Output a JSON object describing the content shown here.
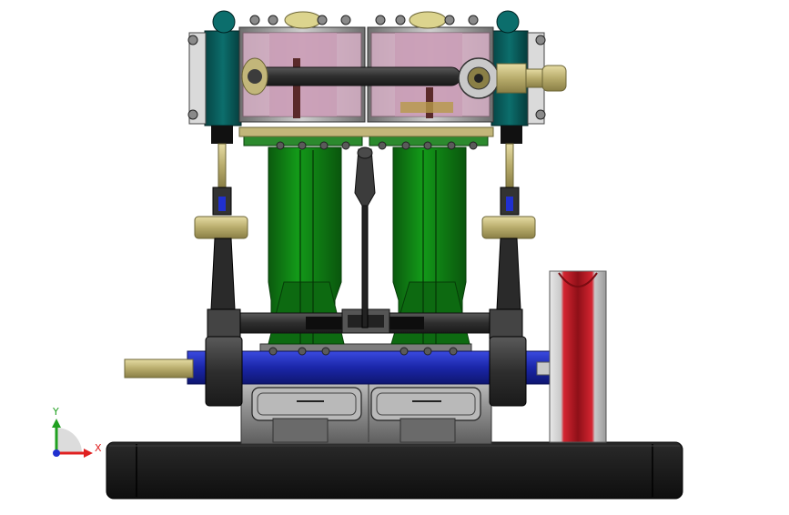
{
  "viewport": {
    "axes": {
      "x_label": "X",
      "y_label": "Y",
      "x_color": "#e02020",
      "y_color": "#20a020",
      "z_color": "#2030d0"
    }
  },
  "colors": {
    "base": "#1b1b1b",
    "frame_green": "#0f7a13",
    "cylinder_teal": "#0a5a5a",
    "glass_pink": "#d8b6c8",
    "shaft_blue": "#1f2fbf",
    "flywheel_red": "#c8202c",
    "brass": "#c2b67a",
    "steel": "#8c8c8c"
  }
}
